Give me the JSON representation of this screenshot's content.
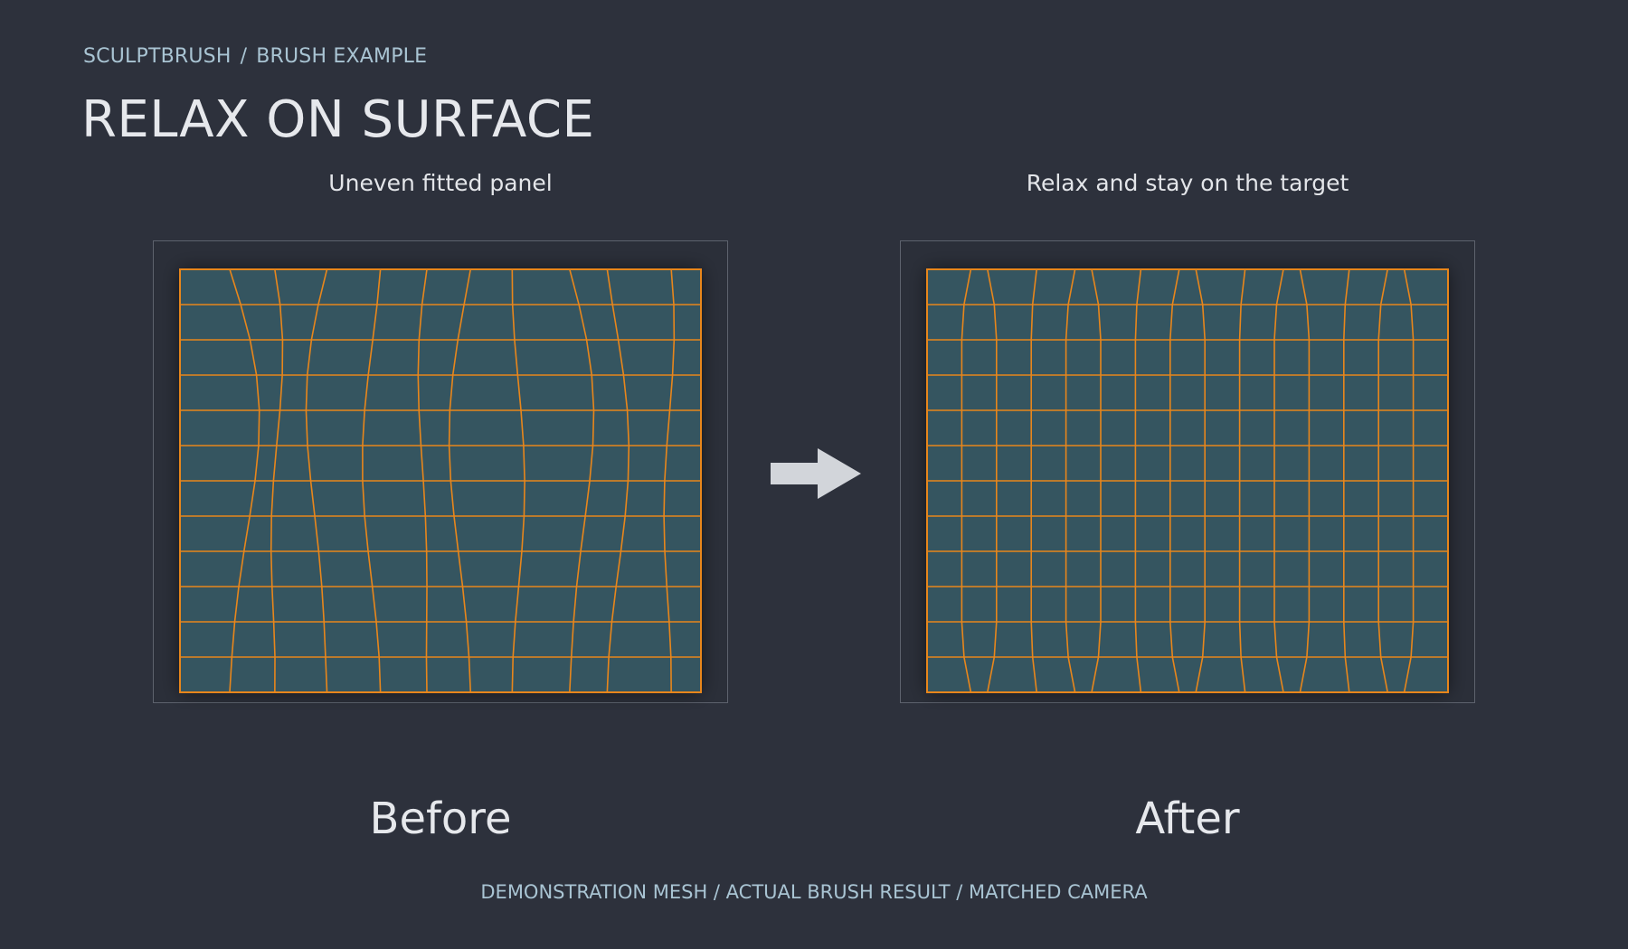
{
  "breadcrumb": {
    "root": "SCULPTBRUSH",
    "separator": "/",
    "current": "BRUSH EXAMPLE"
  },
  "title": "RELAX ON SURFACE",
  "panels": [
    {
      "caption": "Uneven fitted panel",
      "label": "Before",
      "state": "uneven"
    },
    {
      "caption": "Relax and stay on the target",
      "label": "After",
      "state": "relaxed"
    }
  ],
  "arrow_icon": "right-arrow-icon",
  "footer": "DEMONSTRATION MESH / ACTUAL BRUSH RESULT / MATCHED CAMERA",
  "colors": {
    "background": "#2d313c",
    "mesh_fill": "#355560",
    "wire": "#e8861b",
    "text_primary": "#e6e8ec",
    "text_accent": "#a9c4d3",
    "arrow": "#d2d5da"
  }
}
